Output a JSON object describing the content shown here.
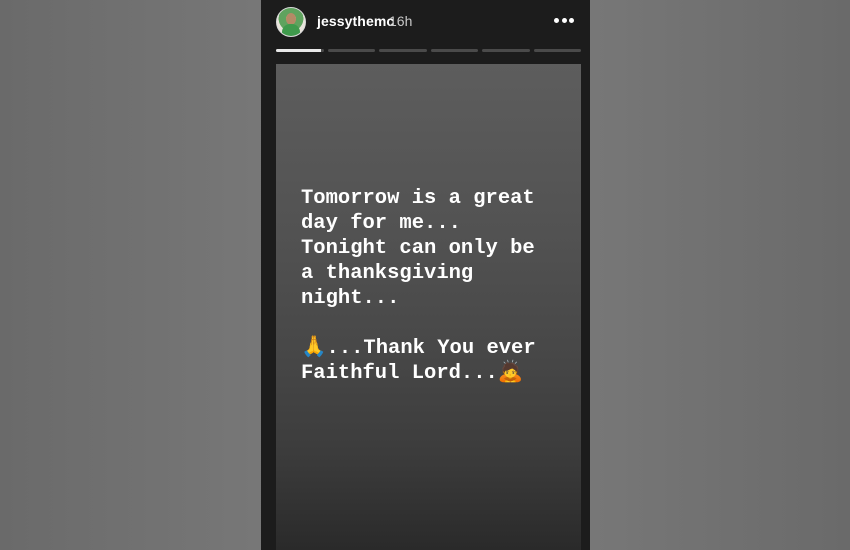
{
  "story": {
    "username": "jessythemc",
    "timestamp": "16h",
    "avatar_icon": "profile-avatar",
    "more_icon": "more-options-icon",
    "progress": {
      "segments": 6,
      "active_index": 0,
      "active_fraction": 0.95
    },
    "text_lines": [
      "Tomorrow is a great",
      "day for me...",
      "Tonight can only be",
      "a thanksgiving",
      "night...",
      "",
      "🙏...Thank You ever",
      "Faithful Lord...🙇"
    ]
  }
}
